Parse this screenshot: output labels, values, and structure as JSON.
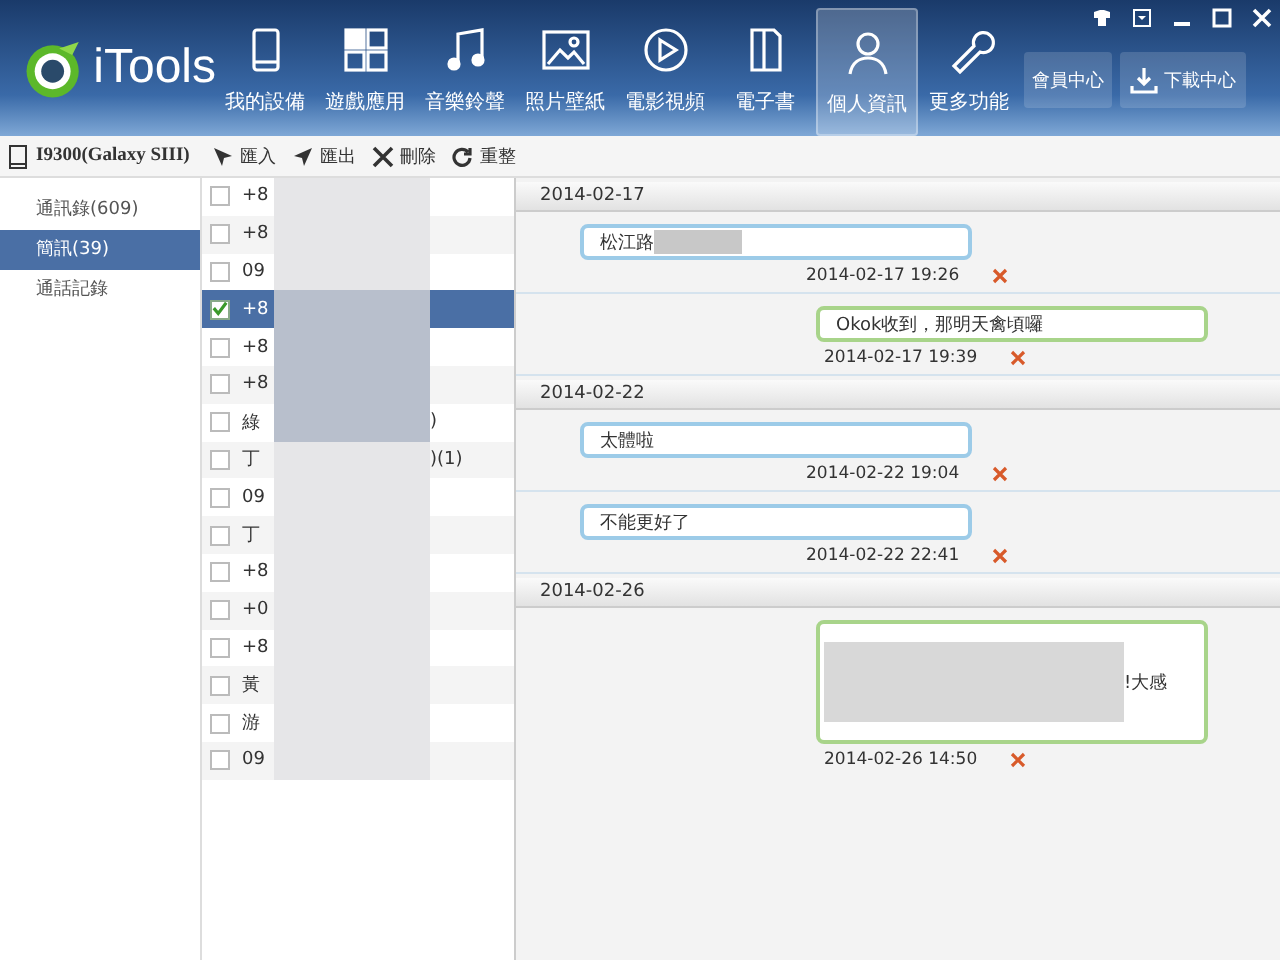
{
  "app": {
    "name": "iTools"
  },
  "nav": [
    {
      "label": "我的設備",
      "selected": false
    },
    {
      "label": "遊戲應用",
      "selected": false
    },
    {
      "label": "音樂鈴聲",
      "selected": false
    },
    {
      "label": "照片壁紙",
      "selected": false
    },
    {
      "label": "電影視頻",
      "selected": false
    },
    {
      "label": "電子書",
      "selected": false
    },
    {
      "label": "個人資訊",
      "selected": true
    },
    {
      "label": "更多功能",
      "selected": false
    }
  ],
  "header_buttons": [
    {
      "label": "會員中心",
      "kind": "plain"
    },
    {
      "label": "下載中心",
      "kind": "download"
    }
  ],
  "device": {
    "name": "I9300(Galaxy SIII)"
  },
  "sidebar": {
    "items": [
      {
        "label": "通訊錄(609)",
        "selected": false
      },
      {
        "label": "簡訊(39)",
        "selected": true
      },
      {
        "label": "通話記錄",
        "selected": false
      }
    ]
  },
  "toolbar": [
    {
      "label": "匯入"
    },
    {
      "label": "匯出"
    },
    {
      "label": "刪除"
    },
    {
      "label": "重整"
    }
  ],
  "threads": [
    {
      "name": "+8",
      "checked": false,
      "selected": false
    },
    {
      "name": "+8",
      "checked": false,
      "selected": false
    },
    {
      "name": "09",
      "checked": false,
      "selected": false
    },
    {
      "name": "+8",
      "checked": true,
      "selected": true
    },
    {
      "name": "+8",
      "checked": false,
      "selected": false
    },
    {
      "name": "+8",
      "checked": false,
      "selected": false
    },
    {
      "name": "綠",
      "count": ")",
      "checked": false,
      "selected": false
    },
    {
      "name": "丁",
      "count": ")(1)",
      "checked": false,
      "selected": false
    },
    {
      "name": "09",
      "checked": false,
      "selected": false
    },
    {
      "name": "丁",
      "checked": false,
      "selected": false
    },
    {
      "name": "+8",
      "checked": false,
      "selected": false
    },
    {
      "name": "+0",
      "checked": false,
      "selected": false
    },
    {
      "name": "+8",
      "checked": false,
      "selected": false
    },
    {
      "name": "黃",
      "checked": false,
      "selected": false
    },
    {
      "name": "游",
      "checked": false,
      "selected": false
    },
    {
      "name": "09",
      "checked": false,
      "selected": false
    }
  ],
  "conversation": [
    {
      "date": "2014-02-17",
      "messages": [
        {
          "kind": "received",
          "text": "松江路",
          "time": "2014-02-17 19:26"
        },
        {
          "kind": "sent",
          "text": "Okok收到，那明天禽頃囉",
          "time": "2014-02-17 19:39"
        }
      ]
    },
    {
      "date": "2014-02-22",
      "messages": [
        {
          "kind": "received",
          "text": "太體啦",
          "time": "2014-02-22 19:04"
        },
        {
          "kind": "received",
          "text": "不能更好了",
          "time": "2014-02-22 22:41"
        }
      ]
    },
    {
      "date": "2014-02-26",
      "messages": [
        {
          "kind": "sent_long",
          "text": "!大感",
          "time": "2014-02-26 14:50"
        }
      ]
    }
  ]
}
